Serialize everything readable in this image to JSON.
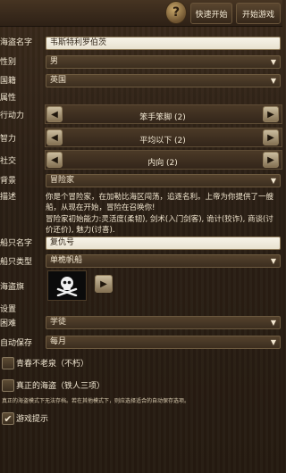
{
  "topbar": {
    "quick_start": "快速开始",
    "start_game": "开始游戏",
    "help": "?"
  },
  "form": {
    "pirate_name": {
      "label": "海盗名字",
      "value": "韦斯特利罗伯茨"
    },
    "gender": {
      "label": "性别",
      "value": "男"
    },
    "nationality": {
      "label": "国籍",
      "value": "英国"
    },
    "attributes_header": "属性",
    "stats": [
      {
        "label": "行动力",
        "value": "笨手笨脚 (2)"
      },
      {
        "label": "智力",
        "value": "平均以下 (2)"
      },
      {
        "label": "社交",
        "value": "内向 (2)"
      }
    ],
    "background": {
      "label": "背景",
      "value": "冒险家"
    },
    "description": {
      "label": "描述",
      "text1": "你是个冒险家，在加勒比海区闯荡，追逐名利。上帝为你提供了一艘船，从现在开始，冒险在召唤你!",
      "text2": "冒险家初始能力:灵活度(柔韧), 剑术(入门剑客), 诡计(狡诈), 商谈(讨价还价), 魅力(讨喜)."
    },
    "ship_name": {
      "label": "船只名字",
      "value": "复仇号"
    },
    "ship_type": {
      "label": "船只类型",
      "value": "单桅帆船"
    },
    "pirate_flag": {
      "label": "海盗旗",
      "icon": "skull-crossbones"
    },
    "settings_header": "设置",
    "difficulty": {
      "label": "困难",
      "value": "学徒"
    },
    "autosave": {
      "label": "自动保存",
      "value": "每月"
    },
    "immortal": {
      "label": "青春不老泉（不朽）",
      "checked": false
    },
    "ironman": {
      "label": "真正的海盗（铁人三项）",
      "checked": false,
      "note": "真正的海盗模式下无法存档。若在其他模式下，则应选择适合的自动保存选项。"
    },
    "hints": {
      "label": "游戏提示",
      "checked": true
    }
  },
  "colors": {
    "background": "#2c2015",
    "field": "#f4efe2",
    "select": "#4a3a28",
    "text": "#f1e6cf"
  }
}
